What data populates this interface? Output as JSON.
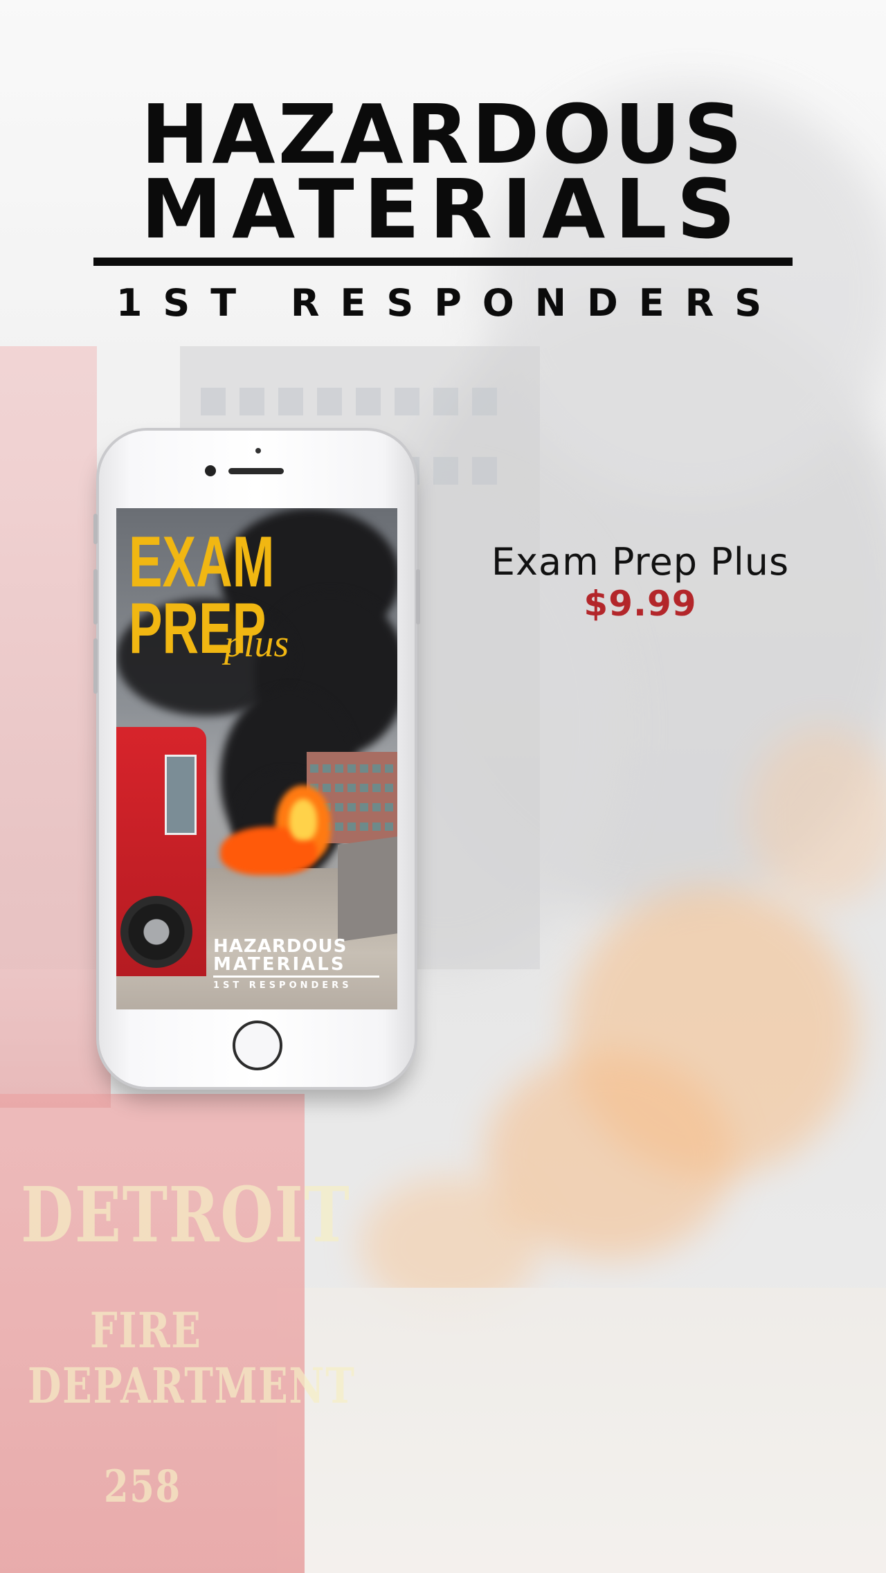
{
  "logo": {
    "line1": "HAZARDOUS",
    "line2": "MATERIALS",
    "line3": "1ST RESPONDERS"
  },
  "phone_screen": {
    "title_exam": "EXAM",
    "title_prep": "PREP",
    "title_plus": "plus",
    "mini_logo": {
      "line1": "HAZARDOUS",
      "line2": "MATERIALS",
      "line3": "1ST RESPONDERS"
    }
  },
  "background": {
    "truck_text_1": "DETROIT",
    "truck_text_2": "FIRE",
    "truck_text_3": "DEPARTMENT",
    "truck_number": "258"
  },
  "product": {
    "name": "Exam Prep Plus",
    "price": "$9.99"
  },
  "colors": {
    "price": "#b3262a",
    "exam_title": "#f1b712",
    "logo": "#0b0b0b"
  }
}
